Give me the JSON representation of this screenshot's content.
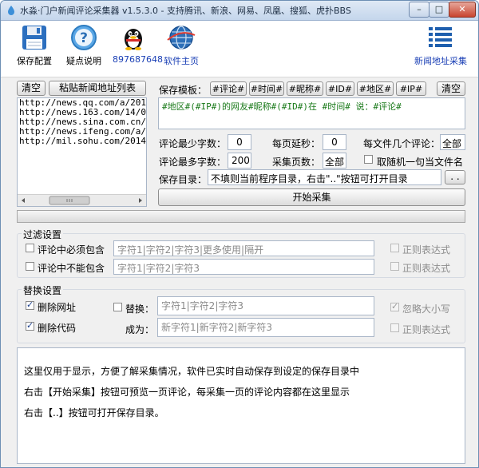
{
  "window": {
    "title": "水淼·门户新闻评论采集器 v1.5.3.0 - 支持腾讯、新浪、网易、凤凰、搜狐、虎扑BBS",
    "min": "–",
    "max": "□",
    "close": "✕"
  },
  "toolbar": {
    "save_config": "保存配置",
    "help": "疑点说明",
    "qq": "897687648",
    "homepage": "软件主页",
    "news_address": "新闻地址采集"
  },
  "urls": {
    "clear": "清空",
    "paste": "粘贴新闻地址列表",
    "items": [
      "http://news.qq.com/a/2017",
      "http://news.163.com/14/0",
      "http://news.sina.com.cn/",
      "http://news.ifeng.com/a/",
      "http://mil.sohu.com/2014"
    ]
  },
  "template": {
    "label": "保存模板：",
    "tags": [
      "#评论#",
      "#时间#",
      "#昵称#",
      "#ID#",
      "#地区#",
      "#IP#"
    ],
    "clear": "清空",
    "value": "#地区#(#IP#)的网友#昵称#(#ID#)在 #时间# 说：#评论#"
  },
  "settings": {
    "min_chars_label": "评论最少字数：",
    "min_chars": "0",
    "page_delay_label": "每页延秒：",
    "page_delay": "0",
    "per_file_label": "每文件几个评论：",
    "per_file": "全部",
    "max_chars_label": "评论最多字数：",
    "max_chars": "200",
    "pages_label": "采集页数：",
    "pages": "全部",
    "random_name_label": "取随机一句当文件名",
    "dir_label": "保存目录：",
    "dir_value": "不填则当前程序目录，右击\"..\"按钮可打开目录",
    "browse": ". ."
  },
  "start_button": "开始采集",
  "filter": {
    "title": "过滤设置",
    "must_contain": "评论中必须包含",
    "must_contain_ph": "字符1|字符2|字符3|更多使用|隔开",
    "not_contain": "评论中不能包含",
    "not_contain_ph": "字符1|字符2|字符3",
    "regex1": "正则表达式",
    "regex2": "正则表达式"
  },
  "replace": {
    "title": "替换设置",
    "del_url": "删除网址",
    "del_code": "删除代码",
    "replace_label": "替换：",
    "replace_ph": "字符1|字符2|字符3",
    "to_label": "成为：",
    "to_ph": "新字符1|新字符2|新字符3",
    "ignore_case": "忽略大小写",
    "regex": "正则表达式"
  },
  "log": [
    "这里仅用于显示，方便了解采集情况，软件已实时自动保存到设定的保存目录中",
    "右击【开始采集】按钮可预览一页评论，每采集一页的评论内容都在这里显示",
    "右击【..】按钮可打开保存目录。"
  ],
  "colors": {
    "accent": "#1a3fb5",
    "template_text": "#1a7a1a"
  }
}
